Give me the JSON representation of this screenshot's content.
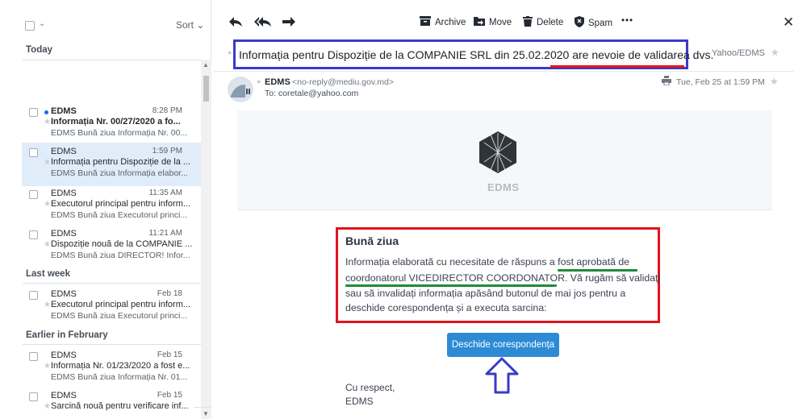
{
  "list_toolbar": {
    "sort_label": "Sort ⌄",
    "select_chevron": "⌄"
  },
  "sections": {
    "today": "Today",
    "last_week": "Last week",
    "earlier": "Earlier in February"
  },
  "messages": [
    {
      "sender": "EDMS",
      "time": "8:28 PM",
      "subject": "Informația Nr. 00/27/2020 a fo...",
      "snippet": "EDMS Bună ziua Informația Nr. 00...",
      "unread": true,
      "selected": false
    },
    {
      "sender": "EDMS",
      "time": "1:59 PM",
      "subject": "Informația pentru Dispoziție de la ...",
      "snippet": "EDMS Bună ziua Informația elabor...",
      "unread": false,
      "selected": true
    },
    {
      "sender": "EDMS",
      "time": "11:35 AM",
      "subject": "Executorul principal pentru inform...",
      "snippet": "EDMS Bună ziua Executorul princi...",
      "unread": false,
      "selected": false
    },
    {
      "sender": "EDMS",
      "time": "11:21 AM",
      "subject": "Dispoziție nouă de la COMPANIE ...",
      "snippet": "EDMS Bună ziua DIRECTOR! Infor...",
      "unread": false,
      "selected": false
    },
    {
      "sender": "EDMS",
      "time": "Feb 18",
      "subject": "Executorul principal pentru inform...",
      "snippet": "EDMS Bună ziua Executorul princi...",
      "unread": false,
      "selected": false
    },
    {
      "sender": "EDMS",
      "time": "Feb 15",
      "subject": "Informația Nr. 01/23/2020 a fost e...",
      "snippet": "EDMS Bună ziua Informația Nr. 01...",
      "unread": false,
      "selected": false
    },
    {
      "sender": "EDMS",
      "time": "Feb 15",
      "subject": "Sarcină nouă pentru verificare inf...",
      "snippet": "",
      "unread": false,
      "selected": false
    }
  ],
  "toolbar": {
    "archive": "Archive",
    "move": "Move",
    "delete": "Delete",
    "spam": "Spam",
    "more": "•••"
  },
  "message": {
    "subject_part1": "Informația pentru Dispoziție de la COMPANIE SRL din 25.02.2020 ",
    "subject_part2": "are nevoie de validarea dvs.",
    "folder": "Yahoo/EDMS",
    "from_name": "EDMS",
    "from_email": "<no-reply@mediu.gov.md>",
    "to": "To: coretale@yahoo.com",
    "date": "Tue, Feb 25 at 1:59 PM"
  },
  "body": {
    "logo_text": "EDMS",
    "greeting": "Bună ziua",
    "line1": "Informația elaborată cu necesitate de răspuns a fost aprobată de",
    "line2": "coordonatorul VICEDIRECTOR COORDONATOR. Vă rugăm să validați",
    "line3": "sau să invalidați informația apăsând butonul de mai jos pentru a",
    "line4": "deschide corespondența și a executa sarcina:",
    "button": "Deschide corespondența",
    "regards": "Cu respect,",
    "signature": "EDMS"
  },
  "colors": {
    "annotation_blue": "#3a3ac8",
    "annotation_red": "#e0141e",
    "annotation_green": "#1f8a3a",
    "button_blue": "#2d8bd6",
    "selected_row": "#e0ecfa"
  }
}
